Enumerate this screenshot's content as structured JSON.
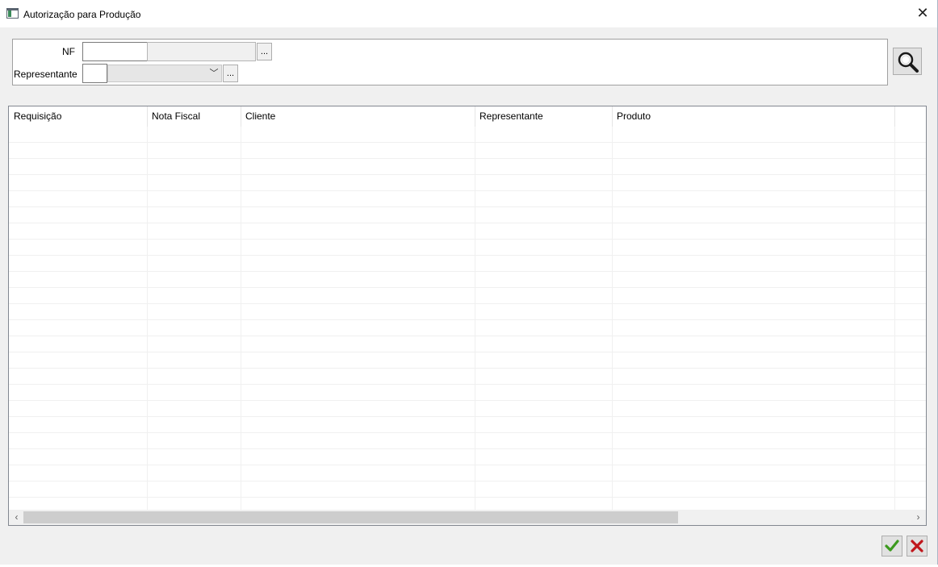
{
  "window": {
    "title": "Autorização para Produção",
    "close_glyph": "✕",
    "icon": "form-window-icon"
  },
  "filters": {
    "nf_label": "NF",
    "representante_label": "Representante",
    "dots_label": "..."
  },
  "grid": {
    "columns": [
      "Requisição",
      "Nota Fiscal",
      "Cliente",
      "Representante",
      "Produto"
    ]
  },
  "icons": {
    "search": "magnifier-icon",
    "ok": "check-icon",
    "cancel": "x-icon"
  },
  "colors": {
    "ok": "#3c9a1e",
    "cancel": "#c0161c"
  }
}
